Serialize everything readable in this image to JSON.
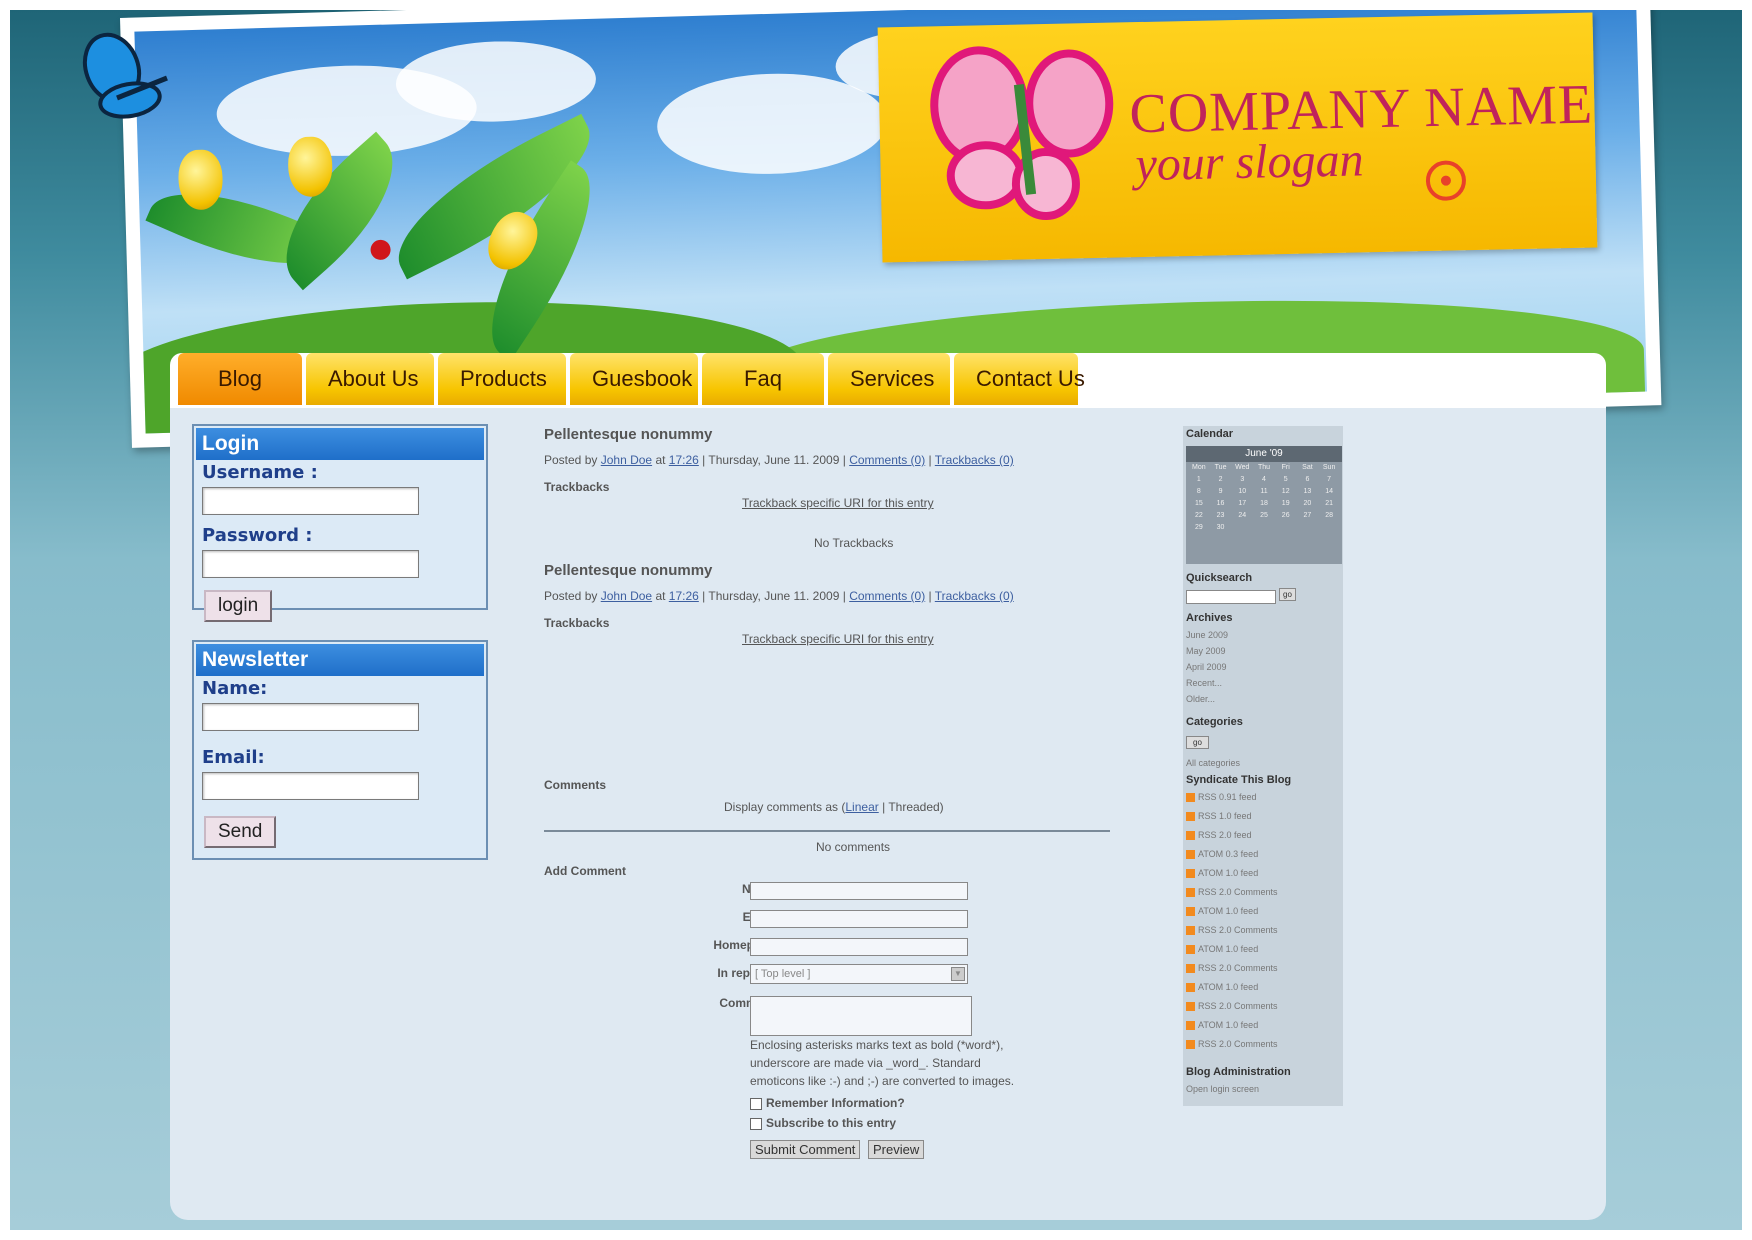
{
  "header": {
    "company": "COMPANY NAME",
    "slogan": "your slogan"
  },
  "nav": [
    "Blog",
    "About Us",
    "Products",
    "Guesbook",
    "Faq",
    "Services",
    "Contact Us"
  ],
  "login": {
    "title": "Login",
    "username_label": "Username :",
    "password_label": "Password :",
    "button": "login"
  },
  "newsletter": {
    "title": "Newsletter",
    "name_label": "Name:",
    "email_label": "Email:",
    "button": "Send"
  },
  "posts": [
    {
      "title": "Pellentesque nonummy",
      "posted_by": "Posted by",
      "author": "John Doe",
      "at": "at",
      "time": "17:26",
      "date": "| Thursday, June 11. 2009 |",
      "comments": "Comments (0)",
      "sep": "|",
      "trackbacks": "Trackbacks (0)",
      "trackbacks_heading": "Trackbacks",
      "trackback_uri": "Trackback specific URI for this entry",
      "no_trackbacks": "No Trackbacks"
    },
    {
      "title": "Pellentesque nonummy",
      "posted_by": "Posted by",
      "author": "John Doe",
      "at": "at",
      "time": "17:26",
      "date": "| Thursday, June 11. 2009 |",
      "comments": "Comments (0)",
      "sep": "|",
      "trackbacks": "Trackbacks (0)",
      "trackbacks_heading": "Trackbacks",
      "trackback_uri": "Trackback specific URI for this entry"
    }
  ],
  "comments": {
    "heading": "Comments",
    "display_as": "Display comments as (",
    "linear": "Linear",
    "threaded": "| Threaded)",
    "none": "No comments",
    "add_heading": "Add Comment",
    "name_label": "Name :",
    "email_label": "Email :",
    "homepage_label": "Homepage :",
    "reply_label": "In reply to :",
    "reply_value": "[ Top level ]",
    "comment_label": "Comment :",
    "help_1": "Enclosing asterisks marks text as bold (*word*),",
    "help_2": "underscore are made via _word_. Standard",
    "help_3": "emoticons like :-) and ;-) are converted to images.",
    "remember": "Remember Information?",
    "subscribe": "Subscribe to this entry",
    "submit": "Submit Comment",
    "preview": "Preview"
  },
  "sidebar": {
    "calendar": "Calendar",
    "month": "June '09",
    "days": [
      "Mon",
      "Tue",
      "Wed",
      "Thu",
      "Fri",
      "Sat",
      "Sun"
    ],
    "dates": [
      "1",
      "2",
      "3",
      "4",
      "5",
      "6",
      "7",
      "8",
      "9",
      "10",
      "11",
      "12",
      "13",
      "14",
      "15",
      "16",
      "17",
      "18",
      "19",
      "20",
      "21",
      "22",
      "23",
      "24",
      "25",
      "26",
      "27",
      "28",
      "29",
      "30"
    ],
    "quicksearch": "Quicksearch",
    "go": "go",
    "archives": "Archives",
    "archive_items": [
      "June 2009",
      "May 2009",
      "April 2009",
      "Recent...",
      "Older..."
    ],
    "categories": "Categories",
    "categories_btn": "go",
    "all_categories": "All categories",
    "syndicate": "Syndicate This Blog",
    "feeds": [
      "RSS 0.91 feed",
      "RSS 1.0 feed",
      "RSS 2.0 feed",
      "ATOM 0.3 feed",
      "ATOM 1.0 feed",
      "RSS 2.0 Comments",
      "ATOM 1.0 feed",
      "RSS 2.0 Comments",
      "ATOM 1.0 feed",
      "RSS 2.0 Comments",
      "ATOM 1.0 feed",
      "RSS 2.0 Comments",
      "ATOM 1.0 feed",
      "RSS 2.0 Comments"
    ],
    "admin": "Blog Administration",
    "login_screen": "Open login screen"
  }
}
